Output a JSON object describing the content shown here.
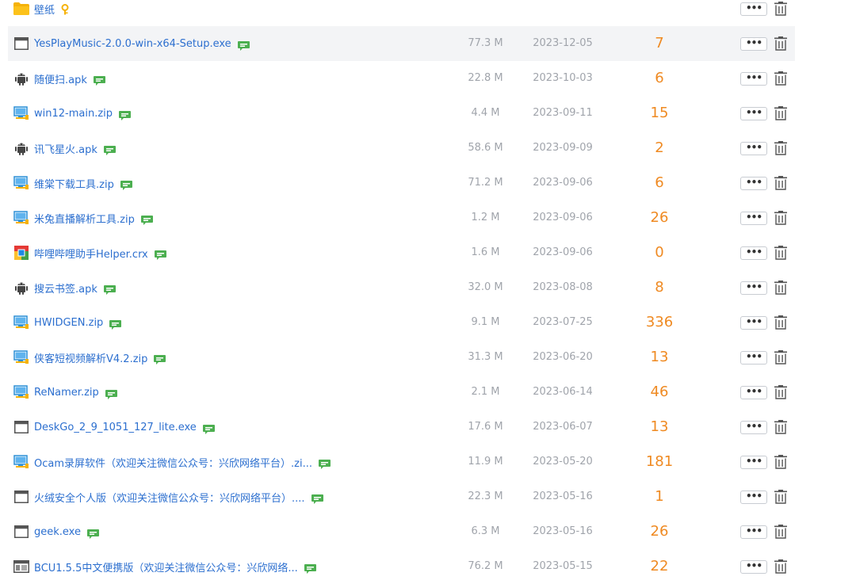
{
  "colors": {
    "link": "#2c6fcf",
    "meta": "#a0a4ab",
    "count": "#ef8a22",
    "hover_row": "#f3f4f6",
    "folder": "#f5b20a",
    "android": "#444444",
    "comment": "#4caf50"
  },
  "more_label": "•••",
  "files": [
    {
      "icon": "folder-icon",
      "name": "壁纸",
      "size": "",
      "date": "",
      "count": "",
      "comment": false,
      "lock": true
    },
    {
      "icon": "window-icon",
      "name": "YesPlayMusic-2.0.0-win-x64-Setup.exe",
      "size": "77.3 M",
      "date": "2023-12-05",
      "count": "7",
      "comment": true,
      "hover": true
    },
    {
      "icon": "android-icon",
      "name": "随便扫.apk",
      "size": "22.8 M",
      "date": "2023-10-03",
      "count": "6",
      "comment": true
    },
    {
      "icon": "archive-icon",
      "name": "win12-main.zip",
      "size": "4.4 M",
      "date": "2023-09-11",
      "count": "15",
      "comment": true
    },
    {
      "icon": "android-icon",
      "name": "讯飞星火.apk",
      "size": "58.6 M",
      "date": "2023-09-09",
      "count": "2",
      "comment": true
    },
    {
      "icon": "archive-icon",
      "name": "维棠下载工具.zip",
      "size": "71.2 M",
      "date": "2023-09-06",
      "count": "6",
      "comment": true
    },
    {
      "icon": "archive-icon",
      "name": "米兔直播解析工具.zip",
      "size": "1.2 M",
      "date": "2023-09-06",
      "count": "26",
      "comment": true
    },
    {
      "icon": "chrome-ext-icon",
      "name": "哔哩哔哩助手Helper.crx",
      "size": "1.6 M",
      "date": "2023-09-06",
      "count": "0",
      "comment": true
    },
    {
      "icon": "android-icon",
      "name": "搜云书签.apk",
      "size": "32.0 M",
      "date": "2023-08-08",
      "count": "8",
      "comment": true
    },
    {
      "icon": "archive-icon",
      "name": "HWIDGEN.zip",
      "size": "9.1 M",
      "date": "2023-07-25",
      "count": "336",
      "comment": true
    },
    {
      "icon": "archive-icon",
      "name": "侠客短视频解析V4.2.zip",
      "size": "31.3 M",
      "date": "2023-06-20",
      "count": "13",
      "comment": true
    },
    {
      "icon": "archive-icon",
      "name": "ReNamer.zip",
      "size": "2.1 M",
      "date": "2023-06-14",
      "count": "46",
      "comment": true
    },
    {
      "icon": "window-icon",
      "name": "DeskGo_2_9_1051_127_lite.exe",
      "size": "17.6 M",
      "date": "2023-06-07",
      "count": "13",
      "comment": true
    },
    {
      "icon": "archive-icon",
      "name": "Ocam录屏软件（欢迎关注微信公众号：兴欣网络平台）.zi...",
      "size": "11.9 M",
      "date": "2023-05-20",
      "count": "181",
      "comment": true
    },
    {
      "icon": "window-icon",
      "name": "火绒安全个人版（欢迎关注微信公众号：兴欣网络平台）....",
      "size": "22.3 M",
      "date": "2023-05-16",
      "count": "1",
      "comment": true
    },
    {
      "icon": "window-icon",
      "name": "geek.exe",
      "size": "6.3 M",
      "date": "2023-05-16",
      "count": "26",
      "comment": true
    },
    {
      "icon": "image-window-icon",
      "name": "BCU1.5.5中文便携版（欢迎关注微信公众号：兴欣网络...",
      "size": "76.2 M",
      "date": "2023-05-15",
      "count": "22",
      "comment": true
    }
  ]
}
